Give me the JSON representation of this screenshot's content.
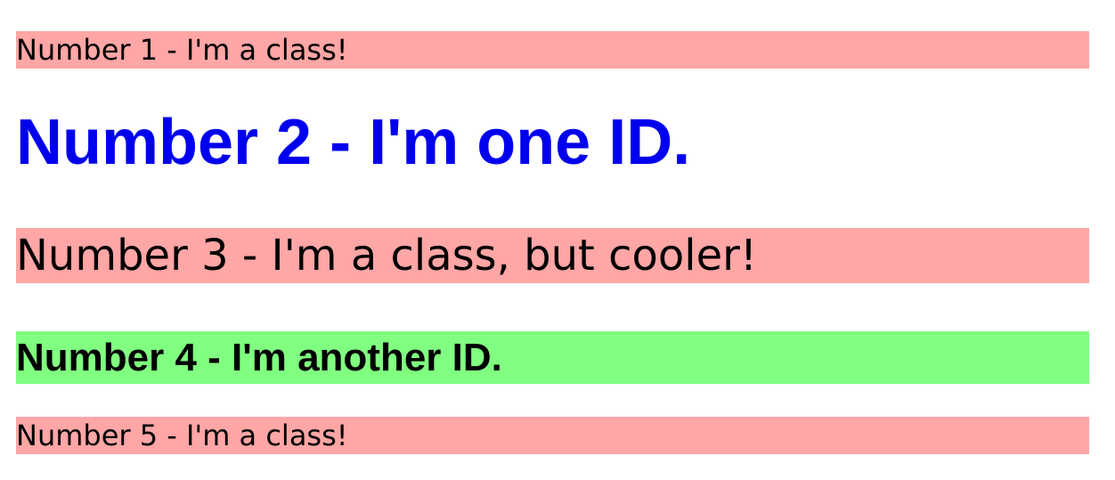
{
  "colors": {
    "class_bg": "#ffa6a6",
    "id_one_text": "#0000ee",
    "id_another_bg": "#80ff80",
    "default_text": "#000000"
  },
  "items": [
    {
      "text": "Number 1 - I'm a class!"
    },
    {
      "text": "Number 2 - I'm one ID."
    },
    {
      "text": "Number 3 - I'm a class, but cooler!"
    },
    {
      "text": "Number 4 - I'm another ID."
    },
    {
      "text": "Number 5 - I'm a class!"
    }
  ]
}
